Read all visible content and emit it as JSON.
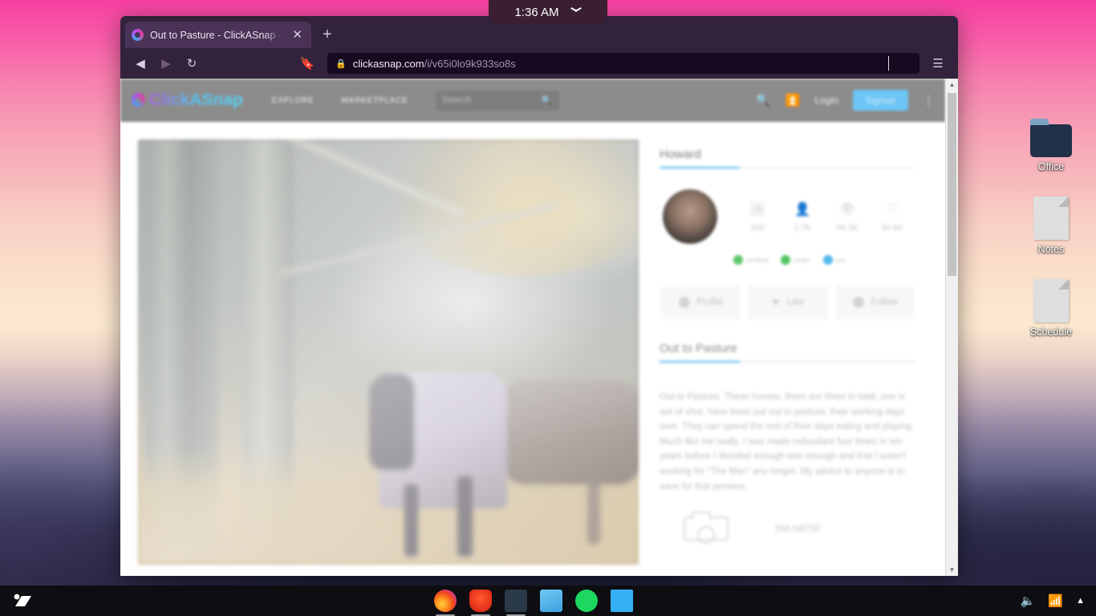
{
  "system": {
    "clock": "1:36 AM",
    "clock_chevron_icon": "chevron-down-icon",
    "tray": {
      "volume_icon": "volume-icon",
      "wifi_icon": "wifi-icon",
      "expand_icon": "caret-up-icon"
    }
  },
  "desktop": {
    "icons": [
      {
        "label": "Office",
        "type": "folder",
        "icon": "folder-icon"
      },
      {
        "label": "Notes",
        "type": "document",
        "icon": "document-icon"
      },
      {
        "label": "Schedule",
        "type": "document",
        "icon": "document-icon"
      }
    ]
  },
  "taskbar": {
    "start_icon": "start-menu-icon",
    "apps": [
      {
        "name": "firefox",
        "icon": "firefox-icon"
      },
      {
        "name": "brave",
        "icon": "brave-icon"
      },
      {
        "name": "file-manager",
        "icon": "file-manager-icon"
      },
      {
        "name": "telegram",
        "icon": "telegram-icon"
      },
      {
        "name": "spotify",
        "icon": "spotify-icon"
      },
      {
        "name": "text-editor",
        "icon": "text-editor-icon"
      }
    ]
  },
  "browser": {
    "tab": {
      "title": "Out to Pasture - ClickASnap -",
      "favicon": "clickasnap-favicon",
      "close_icon": "close-icon"
    },
    "new_tab_label": "+",
    "nav": {
      "back_icon": "back-arrow-icon",
      "forward_icon": "forward-arrow-icon",
      "reload_icon": "reload-icon",
      "bookmark_icon": "bookmark-icon",
      "menu_icon": "hamburger-menu-icon"
    },
    "address_bar": {
      "lock_icon": "padlock-icon",
      "domain": "clickasnap.com",
      "path": "/i/v65i0lo9k933so8s"
    }
  },
  "site": {
    "header": {
      "logo_text": "ClickASnap",
      "logo_mark_icon": "clickasnap-logo-icon",
      "nav": [
        {
          "label": "EXPLORE"
        },
        {
          "label": "MARKETPLACE"
        }
      ],
      "search_placeholder": "Search",
      "search_icon": "search-icon",
      "header_search_icon": "search-icon",
      "upload_icon": "upload-icon",
      "login_label": "Login",
      "signup_label": "Signup",
      "menu_icon": "kebab-menu-icon"
    },
    "photo": {
      "alt": "Two rugged horses standing under a large tree in autumn leaves"
    },
    "profile": {
      "name": "Howard",
      "avatar_icon": "user-avatar",
      "stats": [
        {
          "icon": "photos-icon",
          "name": "photos",
          "value": "350"
        },
        {
          "icon": "followers-icon",
          "name": "followers",
          "value": "2.7K"
        },
        {
          "icon": "views-icon",
          "name": "views",
          "value": "58.3K"
        },
        {
          "icon": "likes-icon",
          "name": "likes",
          "value": "30.6K"
        }
      ],
      "badges": [
        {
          "label": "verified",
          "color": "#5cc46a"
        },
        {
          "label": "seller",
          "color": "#4fc25e"
        },
        {
          "label": "pro",
          "color": "#4fb8ed"
        }
      ],
      "actions": [
        {
          "label": "Profile",
          "icon": "user-circle-icon"
        },
        {
          "label": "Like",
          "icon": "heart-icon"
        },
        {
          "label": "Follow",
          "icon": "plus-circle-icon"
        }
      ]
    },
    "work": {
      "title": "Out to Pasture",
      "description": "Out to Pasture. These horses, there are three in total, one is out of shot, have been put out to pasture, their working days over. They can spend the rest of their days eating and playing. Much like me really. I was made redundant four times in ten years before I decided enough was enough and that I wasn't working for \"The Man\" any longer. My advice to anyone is to save for that pension.",
      "exif": {
        "camera_icon": "camera-icon",
        "camera_model": "SM-N975F"
      }
    }
  },
  "colors": {
    "accent_blue": "#4ab4f0",
    "signup_blue": "#6cc5f5",
    "verified_green": "#5cc46a",
    "pro_blue": "#4fb8ed"
  }
}
